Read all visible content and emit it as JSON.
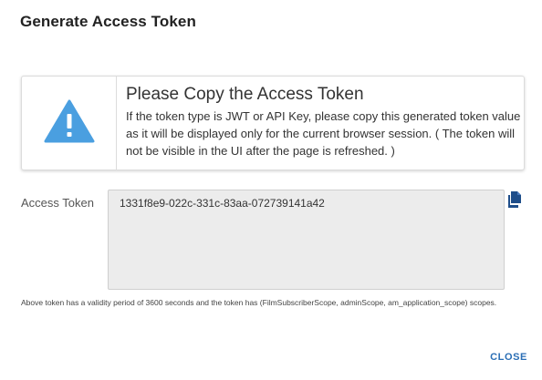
{
  "dialog": {
    "title": "Generate Access Token"
  },
  "warning": {
    "icon": "warning-triangle-icon",
    "icon_color": "#4a9fe0",
    "heading": "Please Copy the Access Token",
    "body": "If the token type is JWT or API Key, please copy this generated token value as it will be displayed only for the current browser session. ( The token will not be visible in the UI after the page is refreshed. )"
  },
  "token": {
    "label": "Access Token",
    "value": "1331f8e9-022c-331c-83aa-072739141a42",
    "copy_icon": "copy-icon",
    "box_color": "#ececec"
  },
  "note": {
    "text": "Above token has a validity period of 3600 seconds and the token has (FilmSubscriberScope, adminScope, am_application_scope) scopes."
  },
  "actions": {
    "close_label": "CLOSE",
    "close_color": "#2a6eb5"
  }
}
